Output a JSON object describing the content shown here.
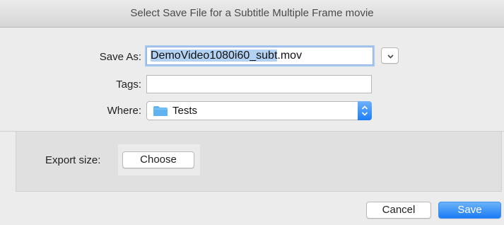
{
  "window": {
    "title": "Select Save File for a Subtitle Multiple Frame movie"
  },
  "form": {
    "save_as_label": "Save As:",
    "filename_selected": "DemoVideo1080i60_subt",
    "filename_ext": ".mov",
    "tags_label": "Tags:",
    "tags_value": "",
    "where_label": "Where:",
    "where_value": "Tests"
  },
  "accessory": {
    "export_size_label": "Export size:",
    "choose_button": "Choose"
  },
  "buttons": {
    "cancel": "Cancel",
    "save": "Save"
  },
  "colors": {
    "accent": "#1b7cf4",
    "folder": "#5fb3f0",
    "selection": "#b3d2f3"
  },
  "icons": {
    "expand": "chevron-down-icon",
    "folder": "folder-icon",
    "stepper": "up-down-arrows-icon"
  }
}
